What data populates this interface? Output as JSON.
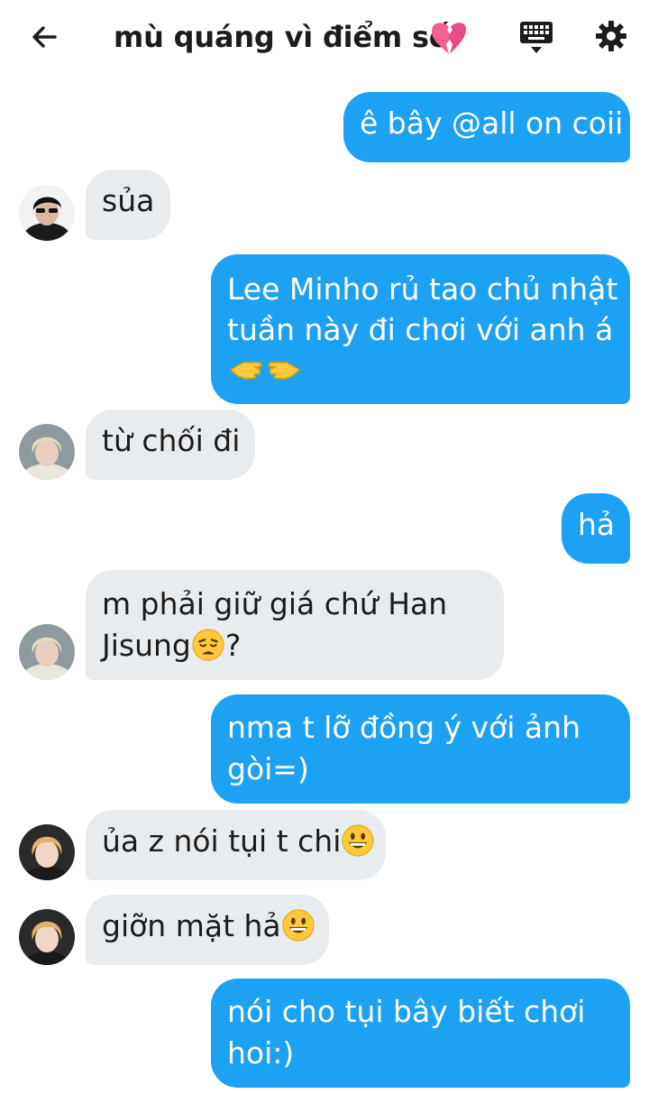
{
  "header": {
    "title": "mù quáng vì điểm số",
    "title_emoji": "broken-heart-emoji",
    "back_icon": "arrow-left-icon",
    "keyboard_icon": "keyboard-icon",
    "settings_icon": "gear-icon"
  },
  "colors": {
    "outgoing_bubble": "#1da1f2",
    "incoming_bubble": "#e9ecef",
    "header_text": "#1c1c1c"
  },
  "messages": [
    {
      "direction": "out",
      "lines": [
        "ê bây @all on coii"
      ]
    },
    {
      "direction": "in",
      "avatar": "avatar-dark-hair-sunglasses",
      "lines": [
        "sủa"
      ]
    },
    {
      "direction": "out",
      "lines": [
        "Lee Minho rủ tao chủ nhật",
        "tuần này đi chơi với anh á"
      ],
      "trailing_emoji": "pointing-hands-emoji"
    },
    {
      "direction": "in",
      "avatar": "avatar-blond-hair",
      "lines": [
        "từ chối đi"
      ]
    },
    {
      "direction": "out",
      "lines": [
        "hả"
      ]
    },
    {
      "direction": "in",
      "avatar": "avatar-blond-hair",
      "lines": [
        "m phải giữ giá chứ Han",
        "Jisung"
      ],
      "inline_emoji": "weary-face-emoji",
      "after_emoji": "?"
    },
    {
      "direction": "out",
      "lines": [
        "nma t lỡ đồng ý với ảnh",
        "gòi=)"
      ]
    },
    {
      "direction": "in",
      "avatar": "avatar-orange-hair",
      "lines": [
        "ủa z nói tụi t chi"
      ],
      "inline_emoji": "grinning-face-emoji"
    },
    {
      "direction": "in",
      "avatar": "avatar-orange-hair",
      "lines": [
        "giỡn mặt hả"
      ],
      "inline_emoji": "grinning-face-emoji"
    },
    {
      "direction": "out",
      "lines": [
        "nói cho tụi bây biết chơi",
        "hoi:)"
      ]
    }
  ]
}
